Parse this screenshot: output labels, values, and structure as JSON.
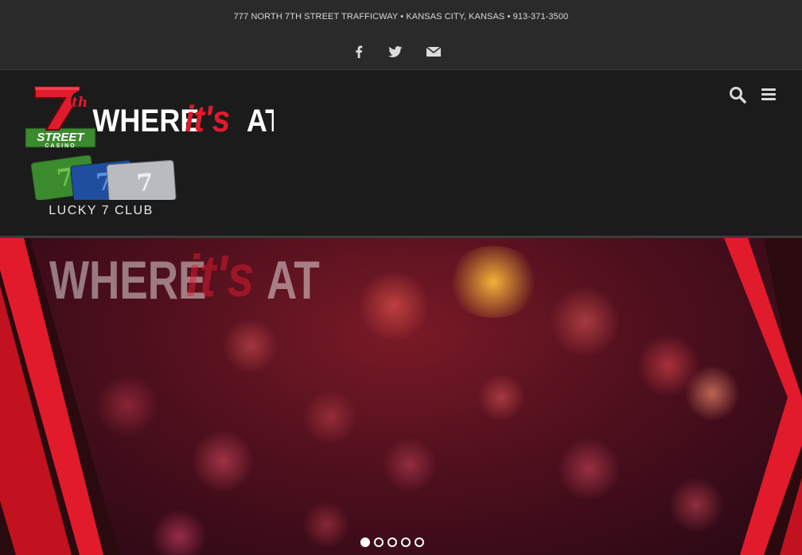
{
  "topbar": {
    "address": "777 NORTH 7TH STREET TRAFFICWAY • KANSAS CITY, KANSAS • 913-371-3500",
    "social": [
      {
        "icon": "facebook-icon"
      },
      {
        "icon": "twitter-icon"
      },
      {
        "icon": "email-icon"
      }
    ]
  },
  "header": {
    "logo": {
      "numeral": "7",
      "superscript": "th",
      "street": "STREET",
      "casino": "CASINO",
      "tagline_where": "WHERE",
      "tagline_its": "it's",
      "tagline_at": "AT"
    },
    "club": {
      "label": "LUCKY 7 CLUB"
    },
    "icons": {
      "search": "search-icon",
      "menu": "menu-icon"
    }
  },
  "hero": {
    "title_where": "WHERE",
    "title_its": "it's",
    "title_at": "AT",
    "slides": [
      {
        "active": true
      },
      {
        "active": false
      },
      {
        "active": false
      },
      {
        "active": false
      },
      {
        "active": false
      }
    ]
  },
  "colors": {
    "accent_red": "#e11b2c",
    "brand_green": "#3c8a2e",
    "topbar_bg": "#2a2a2a",
    "header_bg": "#1b1b1b"
  }
}
